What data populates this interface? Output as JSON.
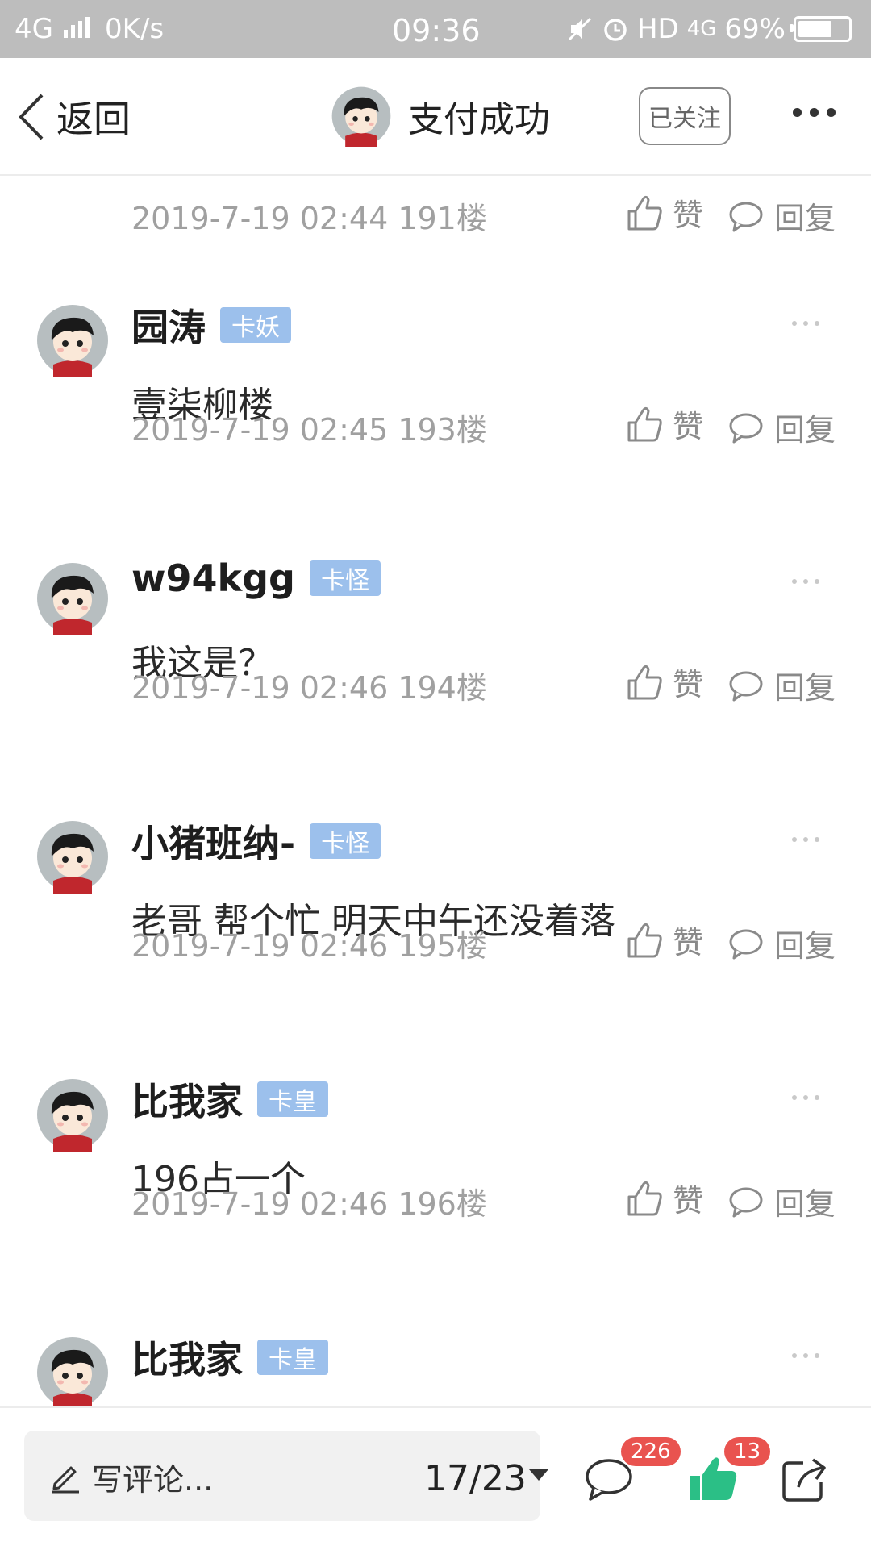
{
  "status_bar": {
    "network": "4G",
    "speed": "0K/s",
    "time": "09:36",
    "right": "HD",
    "right_net": "4G",
    "battery": "69%",
    "battery_level": 0.69
  },
  "nav": {
    "back_label": "返回",
    "title": "支付成功",
    "follow_label": "已关注"
  },
  "first_meta": {
    "meta": "2019-7-19 02:44  191楼"
  },
  "actions": {
    "like": "赞",
    "reply": "回复"
  },
  "comments": [
    {
      "name": "园涛",
      "badge": "卡妖",
      "text": "壹柒柳楼",
      "meta": "2019-7-19 02:45  193楼"
    },
    {
      "name": "w94kgg",
      "badge": "卡怪",
      "text": "我这是？",
      "meta": "2019-7-19 02:46  194楼"
    },
    {
      "name": "小猪班纳-",
      "badge": "卡怪",
      "text": "老哥 帮个忙 明天中午还没着落",
      "meta": "2019-7-19 02:46  195楼"
    },
    {
      "name": "比我家",
      "badge": "卡皇",
      "text": "196占一个",
      "meta": "2019-7-19 02:46  196楼"
    },
    {
      "name": "比我家",
      "badge": "卡皇"
    }
  ],
  "bottom": {
    "write_placeholder": "写评论...",
    "page_indicator": "17/23",
    "comment_count": "226",
    "like_count": "13"
  },
  "colors": {
    "badge": "#9cc0ec",
    "like_active": "#2bbf86",
    "count_badge": "#e9534f",
    "status_bar": "#bdbdbd"
  },
  "icons": [
    "back-chevron-icon",
    "avatar",
    "more-icon",
    "thumbs-up-icon",
    "speech-bubble-icon",
    "pen-icon",
    "share-icon",
    "signal-icon",
    "alarm-icon",
    "mute-icon",
    "battery-icon"
  ]
}
